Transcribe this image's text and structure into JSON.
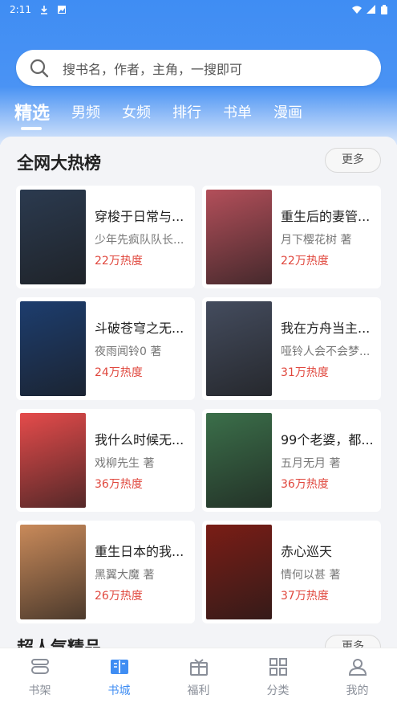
{
  "status_bar": {
    "time": "2:11"
  },
  "search": {
    "placeholder": "搜书名，作者，主角，一搜即可"
  },
  "tabs": [
    {
      "label": "精选",
      "active": true
    },
    {
      "label": "男频",
      "active": false
    },
    {
      "label": "女频",
      "active": false
    },
    {
      "label": "排行",
      "active": false
    },
    {
      "label": "书单",
      "active": false
    },
    {
      "label": "漫画",
      "active": false
    }
  ],
  "section": {
    "title": "全网大热榜",
    "more_label": "更多",
    "books": [
      {
        "title": "穿梭于日常与...",
        "author": "少年先疯队队长...",
        "heat": "22万热度",
        "cover_color": "#2b3a4f"
      },
      {
        "title": "重生后的妻管...",
        "author": "月下樱花树 著",
        "heat": "22万热度",
        "cover_color": "#b34f5a"
      },
      {
        "title": "斗破苍穹之无...",
        "author": "夜雨闻铃0 著",
        "heat": "24万热度",
        "cover_color": "#1d3d6e"
      },
      {
        "title": "我在方舟当主...",
        "author": "哑铃人会不会梦...",
        "heat": "31万热度",
        "cover_color": "#444c5e"
      },
      {
        "title": "我什么时候无...",
        "author": "戏柳先生 著",
        "heat": "36万热度",
        "cover_color": "#e54b4b"
      },
      {
        "title": "99个老婆，都...",
        "author": "五月无月 著",
        "heat": "36万热度",
        "cover_color": "#3b6f4a"
      },
      {
        "title": "重生日本的我...",
        "author": "黑翼大魔 著",
        "heat": "26万热度",
        "cover_color": "#c98a5a"
      },
      {
        "title": "赤心巡天",
        "author": "情何以甚 著",
        "heat": "37万热度",
        "cover_color": "#7a1d16"
      }
    ]
  },
  "next_section": {
    "title": "超人气精品",
    "more_label": "更多"
  },
  "bottom_nav": [
    {
      "label": "书架",
      "icon": "bookshelf-icon",
      "active": false
    },
    {
      "label": "书城",
      "icon": "bookstore-icon",
      "active": true
    },
    {
      "label": "福利",
      "icon": "gift-icon",
      "active": false
    },
    {
      "label": "分类",
      "icon": "category-grid-icon",
      "active": false
    },
    {
      "label": "我的",
      "icon": "profile-icon",
      "active": false
    }
  ],
  "colors": {
    "accent": "#3f8df3",
    "heat": "#e0473d"
  }
}
